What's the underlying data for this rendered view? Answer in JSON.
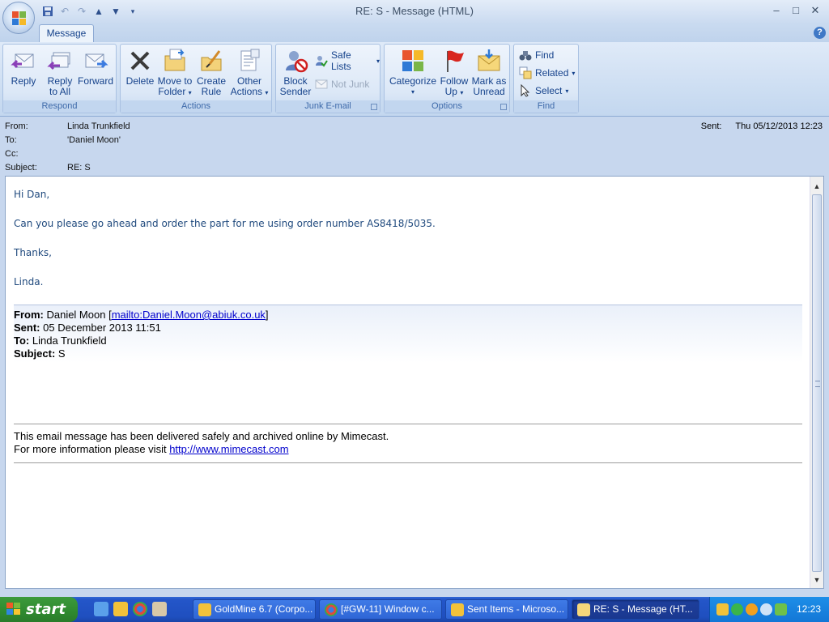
{
  "window": {
    "title": "RE: S - Message (HTML)",
    "controls": {
      "minimize": "–",
      "maximize": "□",
      "close": "✕"
    }
  },
  "qat": [
    "save-icon",
    "undo-icon",
    "redo-icon",
    "previous-item-icon",
    "next-item-icon",
    "customize-qat-icon"
  ],
  "ribbon": {
    "tab": "Message",
    "help": "?",
    "groups": {
      "respond": {
        "label": "Respond",
        "reply": "Reply",
        "reply_all_1": "Reply",
        "reply_all_2": "to All",
        "forward": "Forward"
      },
      "actions": {
        "label": "Actions",
        "delete": "Delete",
        "move_1": "Move to",
        "move_2": "Folder",
        "create_1": "Create",
        "create_2": "Rule",
        "other_1": "Other",
        "other_2": "Actions"
      },
      "junk": {
        "label": "Junk E-mail",
        "block_1": "Block",
        "block_2": "Sender",
        "safe_lists": "Safe Lists",
        "not_junk": "Not Junk"
      },
      "options": {
        "label": "Options",
        "categorize": "Categorize",
        "follow_1": "Follow",
        "follow_2": "Up",
        "mark_1": "Mark as",
        "mark_2": "Unread"
      },
      "find": {
        "label": "Find",
        "find": "Find",
        "related": "Related",
        "select": "Select"
      }
    }
  },
  "headers": {
    "from_label": "From:",
    "from": "Linda Trunkfield",
    "to_label": "To:",
    "to": "'Daniel Moon'",
    "cc_label": "Cc:",
    "cc": "",
    "subject_label": "Subject:",
    "subject": "RE: S",
    "sent_label": "Sent:",
    "sent": "Thu 05/12/2013 12:23"
  },
  "message": {
    "greeting": "Hi Dan,",
    "line1": "Can you please go ahead and order the part for me using order number AS8418/5035.",
    "thanks": "Thanks,",
    "signoff": "Linda.",
    "quoted": {
      "from_label": "From:",
      "from_name": "Daniel Moon [",
      "from_link": "mailto:Daniel.Moon@abiuk.co.uk",
      "from_close": "]",
      "sent_label": "Sent:",
      "sent": "05 December 2013 11:51",
      "to_label": "To:",
      "to": "Linda Trunkfield",
      "subject_label": "Subject:",
      "subject": "S"
    },
    "footer": {
      "line1": "This email message has been delivered safely and archived online by Mimecast.",
      "line2_prefix": "For more information please visit ",
      "link": "http://www.mimecast.com"
    }
  },
  "taskbar": {
    "start": "start",
    "tasks": [
      "GoldMine 6.7 (Corpo...",
      "[#GW-11] Window c...",
      "Sent Items - Microso...",
      "RE: S - Message (HT..."
    ],
    "clock": "12:23"
  },
  "colors": {
    "ribbon_text": "#15428b",
    "body_text": "#1f497d",
    "link": "#0000cc",
    "taskbar": "#2456c9",
    "start": "#2f8a2f"
  }
}
